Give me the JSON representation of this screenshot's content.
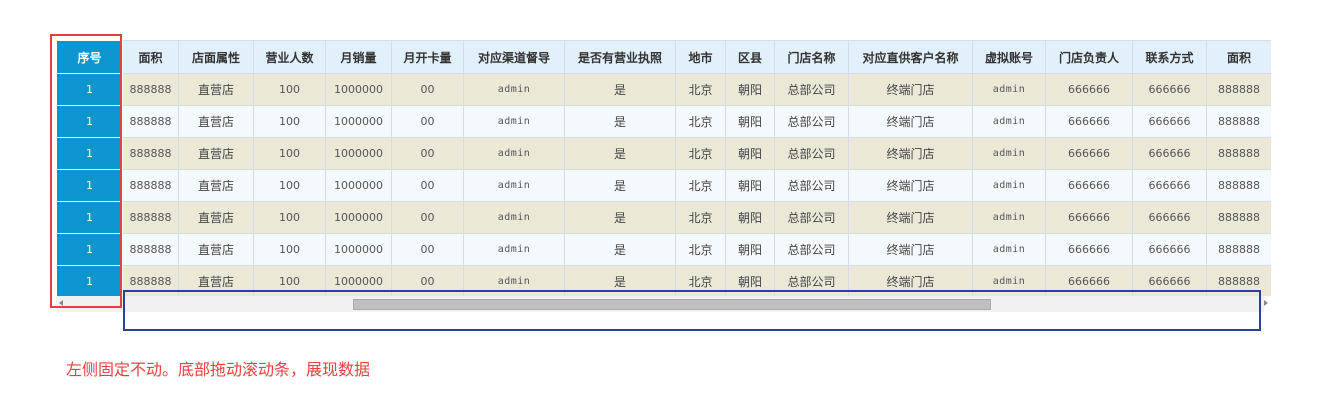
{
  "headers": [
    "序号",
    "面积",
    "店面属性",
    "营业人数",
    "月销量",
    "月开卡量",
    "对应渠道督导",
    "是否有营业执照",
    "地市",
    "区县",
    "门店名称",
    "对应直供客户名称",
    "虚拟账号",
    "门店负责人",
    "联系方式",
    "面积"
  ],
  "rows": [
    [
      "1",
      "888888",
      "直营店",
      "100",
      "1000000",
      "00",
      "admin",
      "是",
      "北京",
      "朝阳",
      "总部公司",
      "终端门店",
      "admin",
      "666666",
      "666666",
      "888888"
    ],
    [
      "1",
      "888888",
      "直营店",
      "100",
      "1000000",
      "00",
      "admin",
      "是",
      "北京",
      "朝阳",
      "总部公司",
      "终端门店",
      "admin",
      "666666",
      "666666",
      "888888"
    ],
    [
      "1",
      "888888",
      "直营店",
      "100",
      "1000000",
      "00",
      "admin",
      "是",
      "北京",
      "朝阳",
      "总部公司",
      "终端门店",
      "admin",
      "666666",
      "666666",
      "888888"
    ],
    [
      "1",
      "888888",
      "直营店",
      "100",
      "1000000",
      "00",
      "admin",
      "是",
      "北京",
      "朝阳",
      "总部公司",
      "终端门店",
      "admin",
      "666666",
      "666666",
      "888888"
    ],
    [
      "1",
      "888888",
      "直营店",
      "100",
      "1000000",
      "00",
      "admin",
      "是",
      "北京",
      "朝阳",
      "总部公司",
      "终端门店",
      "admin",
      "666666",
      "666666",
      "888888"
    ],
    [
      "1",
      "888888",
      "直营店",
      "100",
      "1000000",
      "00",
      "admin",
      "是",
      "北京",
      "朝阳",
      "总部公司",
      "终端门店",
      "admin",
      "666666",
      "666666",
      "888888"
    ],
    [
      "1",
      "888888",
      "直营店",
      "100",
      "1000000",
      "00",
      "admin",
      "是",
      "北京",
      "朝阳",
      "总部公司",
      "终端门店",
      "admin",
      "666666",
      "666666",
      "888888"
    ]
  ],
  "annotation": "左侧固定不动。底部拖动滚动条，展现数据",
  "colors": {
    "fixed_column": "#0d95cf",
    "header_bg": "#e2f0fb",
    "row_odd": "#ebe8d8",
    "row_even": "#f4f9fd",
    "annotation_red": "#e53f3f",
    "annotation_blue": "#2b3fa3"
  }
}
